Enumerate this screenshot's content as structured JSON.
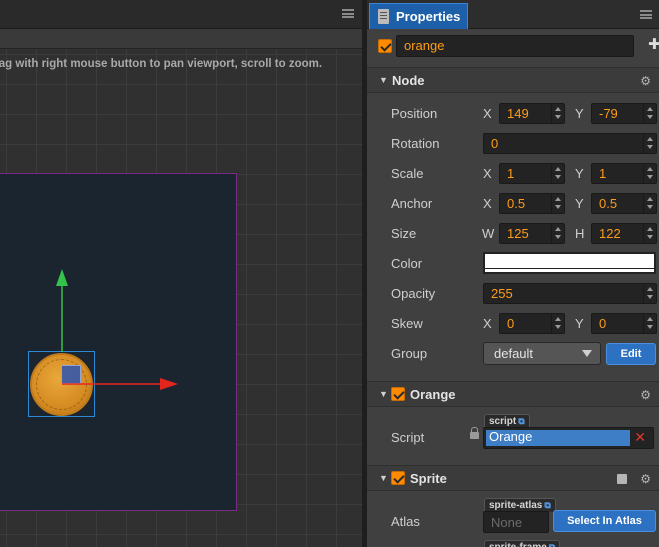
{
  "scene": {
    "hint": "Drag with right mouse button to pan viewport, scroll to zoom.",
    "gizmo_colors": {
      "y_axis": "#34c34a",
      "x_axis": "#e5261f",
      "selection": "#2d8ad9",
      "canvas_border": "#7a2b86"
    }
  },
  "properties": {
    "tab_label": "Properties",
    "node_name": "orange",
    "add_icon": "plus-icon",
    "node_section": {
      "title": "Node",
      "position": {
        "label": "Position",
        "x_label": "X",
        "x": "149",
        "y_label": "Y",
        "y": "-79"
      },
      "rotation": {
        "label": "Rotation",
        "value": "0"
      },
      "scale": {
        "label": "Scale",
        "x_label": "X",
        "x": "1",
        "y_label": "Y",
        "y": "1"
      },
      "anchor": {
        "label": "Anchor",
        "x_label": "X",
        "x": "0.5",
        "y_label": "Y",
        "y": "0.5"
      },
      "size": {
        "label": "Size",
        "w_label": "W",
        "w": "125",
        "h_label": "H",
        "h": "122"
      },
      "color": {
        "label": "Color",
        "value": "#ffffff"
      },
      "opacity": {
        "label": "Opacity",
        "value": "255"
      },
      "skew": {
        "label": "Skew",
        "x_label": "X",
        "x": "0",
        "y_label": "Y",
        "y": "0"
      },
      "group": {
        "label": "Group",
        "value": "default",
        "edit_label": "Edit"
      }
    },
    "orange_section": {
      "title": "Orange",
      "script_label": "Script",
      "asset_tag": "script",
      "script_value": "Orange",
      "remove_icon": "close-icon"
    },
    "sprite_section": {
      "title": "Sprite",
      "atlas_label": "Atlas",
      "atlas_tag": "sprite-atlas",
      "atlas_value": "None",
      "select_atlas_label": "Select In Atlas",
      "frame_tag": "sprite-frame"
    },
    "accent_color": "#ff9c1a",
    "tab_color": "#1d5fa8"
  }
}
